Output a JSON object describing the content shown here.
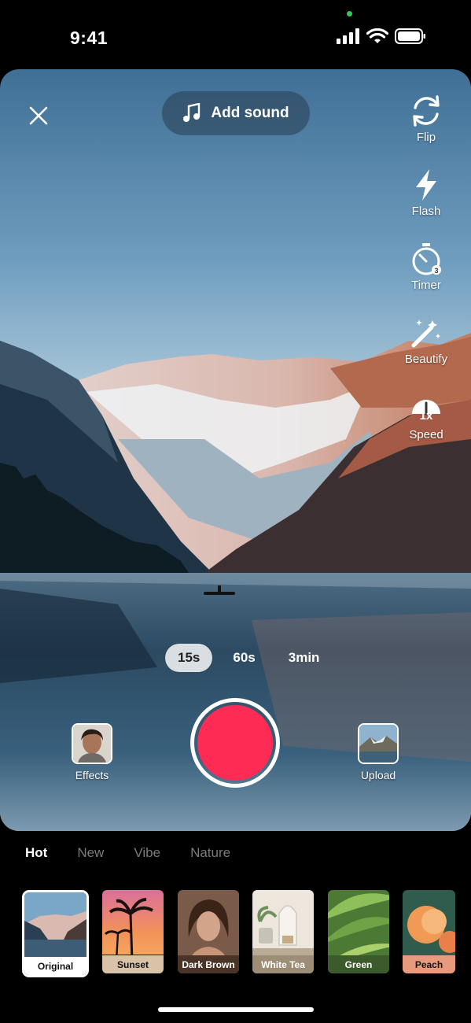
{
  "status": {
    "time": "9:41"
  },
  "camera": {
    "add_sound_label": "Add sound",
    "tools": [
      {
        "name": "flip",
        "label": "Flip",
        "icon": "flip-icon"
      },
      {
        "name": "flash",
        "label": "Flash",
        "icon": "flash-icon"
      },
      {
        "name": "timer",
        "label": "Timer",
        "icon": "timer-icon"
      },
      {
        "name": "beautify",
        "label": "Beautify",
        "icon": "magic-wand-icon"
      },
      {
        "name": "speed",
        "label": "Speed",
        "icon": "speed-icon",
        "value": "1x"
      }
    ],
    "durations": [
      {
        "label": "15s",
        "active": true
      },
      {
        "label": "60s",
        "active": false
      },
      {
        "label": "3min",
        "active": false
      }
    ],
    "effects_label": "Effects",
    "upload_label": "Upload",
    "record_color": "#fe2c55"
  },
  "filters": {
    "tabs": [
      {
        "label": "Hot",
        "active": true
      },
      {
        "label": "New",
        "active": false
      },
      {
        "label": "Vibe",
        "active": false
      },
      {
        "label": "Nature",
        "active": false
      }
    ],
    "items": [
      {
        "label": "Original",
        "selected": true
      },
      {
        "label": "Sunset",
        "selected": false
      },
      {
        "label": "Dark Brown",
        "selected": false
      },
      {
        "label": "White Tea",
        "selected": false
      },
      {
        "label": "Green",
        "selected": false
      },
      {
        "label": "Peach",
        "selected": false
      }
    ]
  }
}
